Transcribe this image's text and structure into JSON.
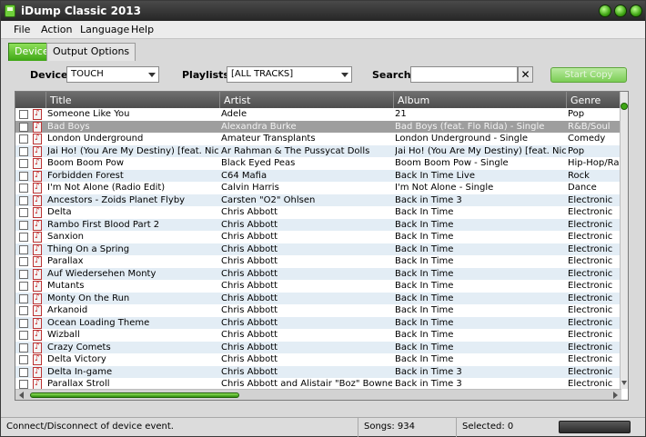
{
  "window": {
    "title": "iDump Classic 2013",
    "accent": "#3ea614"
  },
  "menu": [
    "File",
    "Action",
    "Language",
    "Help"
  ],
  "tabs": [
    {
      "label": "Device",
      "active": true
    },
    {
      "label": "Output Options",
      "active": false
    }
  ],
  "toolbar": {
    "device_label": "Device",
    "device_value": "TOUCH",
    "playlists_label": "Playlists",
    "playlists_value": "[ALL TRACKS]",
    "search_label": "Search",
    "search_value": "",
    "clear_icon": "close-icon",
    "start_copy_label": "Start Copy"
  },
  "table": {
    "columns": [
      "Title",
      "Artist",
      "Album",
      "Genre"
    ],
    "rows": [
      {
        "title": "Someone Like You",
        "artist": "Adele",
        "album": "21",
        "genre": "Pop"
      },
      {
        "title": "Bad Boys",
        "artist": "Alexandra Burke",
        "album": "Bad Boys (feat. Flo Rida) - Single",
        "genre": "R&B/Soul",
        "selected": true
      },
      {
        "title": "London Underground",
        "artist": "Amateur Transplants",
        "album": "London Underground - Single",
        "genre": "Comedy"
      },
      {
        "title": "Jai Ho! (You Are My Destiny) [feat. Nic...",
        "artist": "Ar Rahman & The Pussycat Dolls",
        "album": "Jai Ho! (You Are My Destiny) [feat. Nic...",
        "genre": "Pop"
      },
      {
        "title": "Boom Boom Pow",
        "artist": "Black Eyed Peas",
        "album": "Boom Boom Pow - Single",
        "genre": "Hip-Hop/Rap"
      },
      {
        "title": "Forbidden Forest",
        "artist": "C64 Mafia",
        "album": "Back In Time Live",
        "genre": "Rock"
      },
      {
        "title": "I'm Not Alone (Radio Edit)",
        "artist": "Calvin Harris",
        "album": "I'm Not Alone - Single",
        "genre": "Dance"
      },
      {
        "title": "Ancestors - Zoids Planet Flyby",
        "artist": "Carsten \"O2\" Ohlsen",
        "album": "Back in Time 3",
        "genre": "Electronic"
      },
      {
        "title": "Delta",
        "artist": "Chris Abbott",
        "album": "Back In Time",
        "genre": "Electronic"
      },
      {
        "title": "Rambo First Blood Part 2",
        "artist": "Chris Abbott",
        "album": "Back In Time",
        "genre": "Electronic"
      },
      {
        "title": "Sanxion",
        "artist": "Chris Abbott",
        "album": "Back In Time",
        "genre": "Electronic"
      },
      {
        "title": "Thing On a Spring",
        "artist": "Chris Abbott",
        "album": "Back In Time",
        "genre": "Electronic"
      },
      {
        "title": "Parallax",
        "artist": "Chris Abbott",
        "album": "Back In Time",
        "genre": "Electronic"
      },
      {
        "title": "Auf Wiedersehen Monty",
        "artist": "Chris Abbott",
        "album": "Back In Time",
        "genre": "Electronic"
      },
      {
        "title": "Mutants",
        "artist": "Chris Abbott",
        "album": "Back In Time",
        "genre": "Electronic"
      },
      {
        "title": "Monty On the Run",
        "artist": "Chris Abbott",
        "album": "Back In Time",
        "genre": "Electronic"
      },
      {
        "title": "Arkanoid",
        "artist": "Chris Abbott",
        "album": "Back In Time",
        "genre": "Electronic"
      },
      {
        "title": "Ocean Loading Theme",
        "artist": "Chris Abbott",
        "album": "Back In Time",
        "genre": "Electronic"
      },
      {
        "title": "Wizball",
        "artist": "Chris Abbott",
        "album": "Back In Time",
        "genre": "Electronic"
      },
      {
        "title": "Crazy Comets",
        "artist": "Chris Abbott",
        "album": "Back In Time",
        "genre": "Electronic"
      },
      {
        "title": "Delta Victory",
        "artist": "Chris Abbott",
        "album": "Back In Time",
        "genre": "Electronic"
      },
      {
        "title": "Delta In-game",
        "artist": "Chris Abbott",
        "album": "Back in Time 3",
        "genre": "Electronic"
      },
      {
        "title": "Parallax Stroll",
        "artist": "Chris Abbott and Alistair \"Boz\" Bowness",
        "album": "Back in Time 3",
        "genre": "Electronic"
      }
    ]
  },
  "status": {
    "message": "Connect/Disconnect of device event.",
    "songs": "Songs: 934",
    "selected": "Selected: 0"
  }
}
